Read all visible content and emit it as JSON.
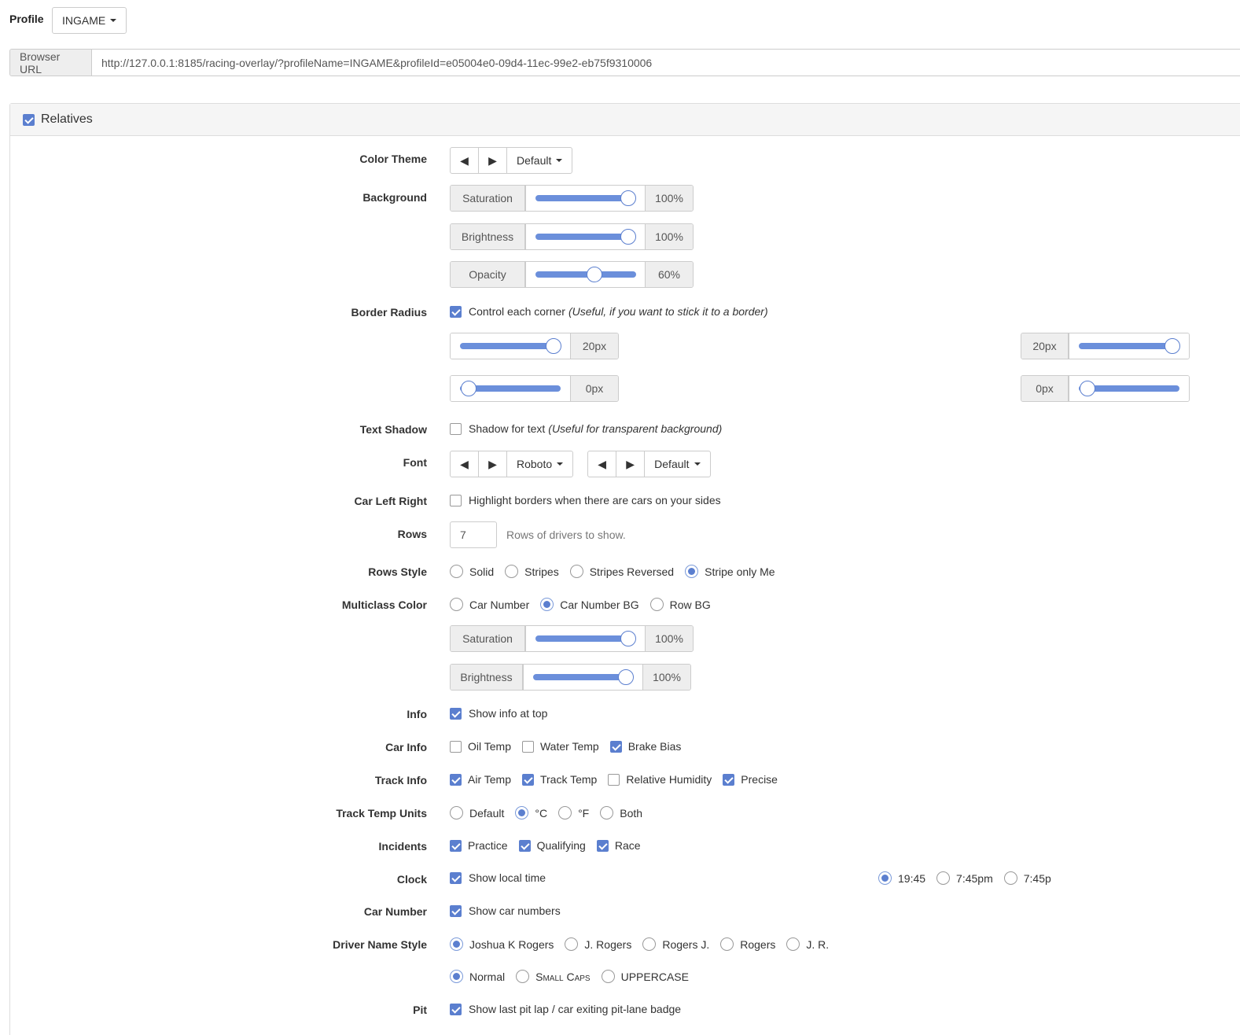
{
  "profile": {
    "label": "Profile",
    "value": "INGAME"
  },
  "url": {
    "label": "Browser URL",
    "value": "http://127.0.0.1:8185/racing-overlay/?profileName=INGAME&profileId=e05004e0-09d4-11ec-99e2-eb75f9310006"
  },
  "panel": {
    "title": "Relatives",
    "enabled": true
  },
  "color_theme": {
    "label": "Color Theme",
    "prev": "◀",
    "next": "▶",
    "value": "Default"
  },
  "background": {
    "label": "Background",
    "saturation": {
      "label": "Saturation",
      "value": "100%",
      "level": 1.0
    },
    "brightness": {
      "label": "Brightness",
      "value": "100%",
      "level": 1.0
    },
    "opacity": {
      "label": "Opacity",
      "value": "60%",
      "level": 0.6
    }
  },
  "border_radius": {
    "label": "Border Radius",
    "option_text": "Control each corner",
    "option_hint": "(Useful, if you want to stick it to a border)",
    "top_left": {
      "value": "20px",
      "level": 1.0
    },
    "top_right": {
      "value": "20px",
      "level": 1.0
    },
    "bottom_left": {
      "value": "0px",
      "level": 0.0
    },
    "bottom_right": {
      "value": "0px",
      "level": 0.0
    }
  },
  "text_shadow": {
    "label": "Text Shadow",
    "option_text": "Shadow for text",
    "option_hint": "(Useful for transparent background)"
  },
  "font": {
    "label": "Font",
    "prev": "◀",
    "next": "▶",
    "family": "Roboto",
    "weight": "Default"
  },
  "car_left_right": {
    "label": "Car Left Right",
    "option_text": "Highlight borders when there are cars on your sides"
  },
  "rows": {
    "label": "Rows",
    "value": "7",
    "help": "Rows of drivers to show."
  },
  "rows_style": {
    "label": "Rows Style",
    "options": [
      "Solid",
      "Stripes",
      "Stripes Reversed",
      "Stripe only Me"
    ]
  },
  "multiclass": {
    "label": "Multiclass Color",
    "options": [
      "Car Number",
      "Car Number BG",
      "Row BG"
    ],
    "saturation": {
      "label": "Saturation",
      "value": "100%",
      "level": 1.0
    },
    "brightness": {
      "label": "Brightness",
      "value": "100%",
      "level": 1.0
    }
  },
  "info": {
    "label": "Info",
    "option_text": "Show info at top"
  },
  "car_info": {
    "label": "Car Info",
    "options": [
      "Oil Temp",
      "Water Temp",
      "Brake Bias"
    ]
  },
  "track_info": {
    "label": "Track Info",
    "options": [
      "Air Temp",
      "Track Temp",
      "Relative Humidity",
      "Precise"
    ]
  },
  "track_temp_units": {
    "label": "Track Temp Units",
    "options": [
      "Default",
      "°C",
      "°F",
      "Both"
    ]
  },
  "incidents": {
    "label": "Incidents",
    "options": [
      "Practice",
      "Qualifying",
      "Race"
    ]
  },
  "clock": {
    "label": "Clock",
    "option_text": "Show local time",
    "formats": [
      "19:45",
      "7:45pm",
      "7:45p"
    ]
  },
  "car_number": {
    "label": "Car Number",
    "option_text": "Show car numbers"
  },
  "driver_name_style": {
    "label": "Driver Name Style",
    "options": [
      "Joshua K Rogers",
      "J. Rogers",
      "Rogers J.",
      "Rogers",
      "J. R."
    ],
    "case_options": [
      "Normal",
      "Small Caps",
      "UPPERCASE"
    ]
  },
  "pit": {
    "label": "Pit",
    "option_text": "Show last pit lap / car exiting pit-lane badge"
  },
  "colors": {
    "accent": "#5b7fcf",
    "slider": "#6b8fdb"
  }
}
